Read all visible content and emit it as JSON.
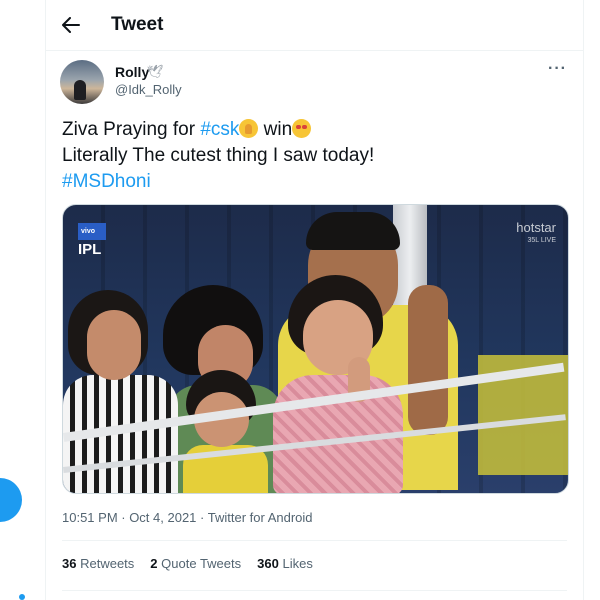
{
  "header": {
    "title": "Tweet"
  },
  "author": {
    "display_name": "Rolly",
    "handle": "@Idk_Rolly",
    "badge_icon": "dove-icon"
  },
  "tweet": {
    "line1_prefix": "Ziva Praying for ",
    "hashtag_csk": "#csk",
    "line1_suffix": " win",
    "line2": "Literally The cutest thing I saw today!",
    "hashtag_msdhoni": "#MSDhoni"
  },
  "media": {
    "overlay_logo": "IPL",
    "overlay_sponsor": "vivo",
    "overlay_brand": "hotstar",
    "overlay_sub": "35L LIVE"
  },
  "meta": {
    "time": "10:51 PM · Oct 4, 2021 · ",
    "source": "Twitter for Android"
  },
  "stats": {
    "retweets_count": "36",
    "retweets_label": "Retweets",
    "quotes_count": "2",
    "quotes_label": "Quote Tweets",
    "likes_count": "360",
    "likes_label": "Likes"
  },
  "colors": {
    "accent": "#1d9bf0",
    "text": "#0f1419",
    "muted": "#536471"
  }
}
